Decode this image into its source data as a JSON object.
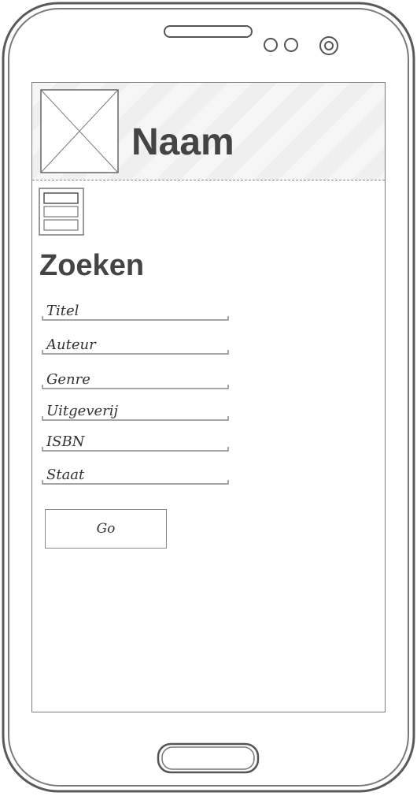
{
  "header": {
    "title": "Naam",
    "logo_icon": "image-placeholder-icon"
  },
  "menu": {
    "icon": "list-menu-icon"
  },
  "search": {
    "title": "Zoeken",
    "fields": [
      {
        "label": "Titel"
      },
      {
        "label": "Auteur"
      },
      {
        "label": "Genre"
      },
      {
        "label": "Uitgeverij"
      },
      {
        "label": "ISBN"
      },
      {
        "label": "Staat"
      }
    ],
    "go_label": "Go"
  },
  "colors": {
    "stroke": "#7a7a7a",
    "text": "#444444",
    "header_bg": "#f3f3f3"
  }
}
